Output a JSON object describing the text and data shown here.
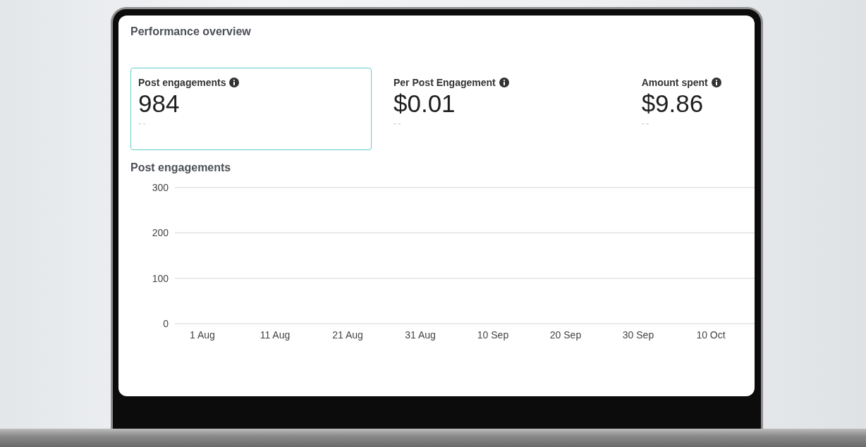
{
  "title": "Performance overview",
  "metrics": [
    {
      "label": "Post engagements",
      "value": "984",
      "comparison": "--",
      "selected": true
    },
    {
      "label": "Per Post Engagement",
      "value": "$0.01",
      "comparison": "--",
      "selected": false
    },
    {
      "label": "Amount spent",
      "value": "$9.86",
      "comparison": "--",
      "selected": false
    }
  ],
  "chart": {
    "title": "Post engagements",
    "chart_data": {
      "type": "line",
      "categories": [
        "1 Aug",
        "11 Aug",
        "21 Aug",
        "31 Aug",
        "10 Sep",
        "20 Sep",
        "30 Sep",
        "10 Oct"
      ],
      "ylim": [
        0,
        300
      ],
      "yticks": [
        0,
        100,
        200,
        300
      ]
    }
  }
}
